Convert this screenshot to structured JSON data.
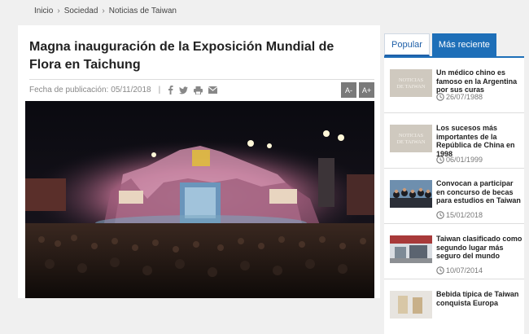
{
  "breadcrumb": {
    "items": [
      "Inicio",
      "Sociedad",
      "Noticias de Taiwan"
    ]
  },
  "article": {
    "title": "Magna inauguración de la Exposición Mundial de Flora en Taichung",
    "date_label": "Fecha de publicación:",
    "date_value": "05/11/2018",
    "separator": "|",
    "font_decrease": "A-",
    "font_increase": "A+"
  },
  "sidebar": {
    "tabs": [
      "Popular",
      "Más reciente"
    ],
    "thumb_logo_line1": "NOTICIAS",
    "thumb_logo_line2": "DE TAIWAN",
    "items": [
      {
        "title": "Un médico chino es famoso en la Argentina por sus curas",
        "date": "26/07/1988"
      },
      {
        "title": "Los sucesos más importantes de la República de China en 1998",
        "date": "06/01/1999"
      },
      {
        "title": "Convocan a participar en concurso de becas para estudios en Taiwan",
        "date": "15/01/2018"
      },
      {
        "title": "Taiwan clasificado como segundo lugar más seguro del mundo",
        "date": "10/07/2014"
      },
      {
        "title": "Bebida típica de Taiwan conquista Europa",
        "date": ""
      }
    ]
  },
  "icons": {
    "share": [
      "facebook-icon",
      "twitter-icon",
      "print-icon",
      "email-icon"
    ],
    "date": "clock-icon"
  },
  "colors": {
    "accent": "#1e6fb8",
    "page_bg": "#f0f0f0",
    "button_gray": "#7a7a7a"
  }
}
